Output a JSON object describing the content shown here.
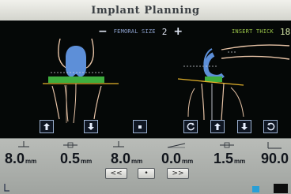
{
  "app": {
    "title": "Implant Planning"
  },
  "femoral_size": {
    "minus": "−",
    "label": "FEMORAL SIZE",
    "value": "2",
    "plus": "+"
  },
  "insert_thickness": {
    "label": "INSERT THICK",
    "value": "18"
  },
  "readouts": [
    {
      "value": "8.0",
      "unit": "mm"
    },
    {
      "value": "0.5",
      "unit": "mm"
    },
    {
      "value": "8.0",
      "unit": "mm"
    },
    {
      "value": "0.0",
      "unit": "mm"
    },
    {
      "value": "1.5",
      "unit": "mm"
    },
    {
      "value": "90.0"
    }
  ],
  "navigation": {
    "prev": "<<",
    "center": "•",
    "next": ">>"
  },
  "colors": {
    "femoral_component": "#5d8fd8",
    "tibial_insert": "#3fae3e",
    "resection_line": "#e3b12a",
    "bone_outline": "#e7c3a6"
  },
  "view_buttons": {
    "front_up": "arrow-up-icon",
    "front_down": "arrow-down-icon",
    "front_center": "center-dot-icon",
    "side_rotate_ccw": "rotate-left-icon",
    "side_up": "arrow-up-icon",
    "side_down": "arrow-down-icon",
    "side_rotate_cw": "rotate-right-icon"
  }
}
